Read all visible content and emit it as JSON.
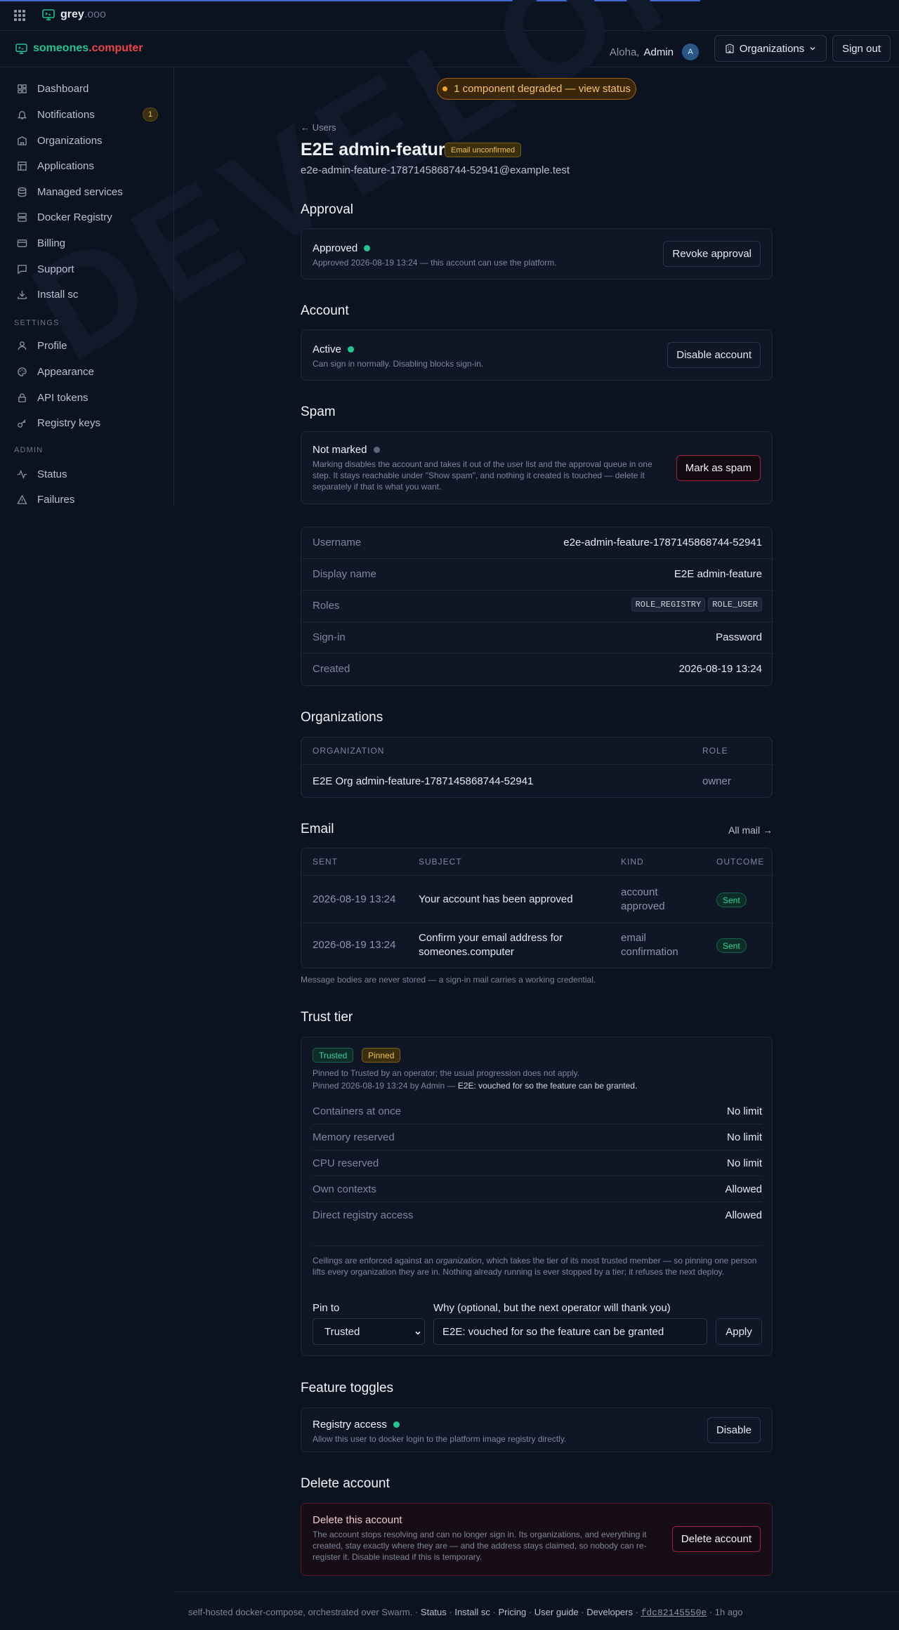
{
  "topbar": {
    "brand_main": "grey",
    "brand_suffix": ".ooo"
  },
  "header": {
    "logo_a": "someones",
    "logo_b": ".computer",
    "greeting": "Aloha,",
    "user_name": "Admin",
    "avatar_initial": "A",
    "org_button": "Organizations",
    "signout_button": "Sign out"
  },
  "sidebar": {
    "items": [
      {
        "label": "Dashboard",
        "icon": "dashboard-icon"
      },
      {
        "label": "Notifications",
        "icon": "bell-icon",
        "badge": "1"
      },
      {
        "label": "Organizations",
        "icon": "building-icon"
      },
      {
        "label": "Applications",
        "icon": "layout-icon"
      },
      {
        "label": "Managed services",
        "icon": "database-icon"
      },
      {
        "label": "Docker Registry",
        "icon": "server-icon"
      },
      {
        "label": "Billing",
        "icon": "card-icon"
      },
      {
        "label": "Support",
        "icon": "chat-icon"
      },
      {
        "label": "Install sc",
        "icon": "download-icon"
      }
    ],
    "settings_label": "SETTINGS",
    "settings_items": [
      {
        "label": "Profile",
        "icon": "user-icon"
      },
      {
        "label": "Appearance",
        "icon": "palette-icon"
      },
      {
        "label": "API tokens",
        "icon": "lock-icon"
      },
      {
        "label": "Registry keys",
        "icon": "key-icon"
      }
    ],
    "admin_label": "ADMIN",
    "admin_items": [
      {
        "label": "Status",
        "icon": "activity-icon"
      },
      {
        "label": "Failures",
        "icon": "warning-icon"
      }
    ]
  },
  "banner": {
    "status_text": "1 component degraded — view status"
  },
  "user": {
    "back_link": "← Users",
    "title": "E2E admin-feature",
    "email_badge": "Email unconfirmed",
    "email": "e2e-admin-feature-1787145868744-52941@example.test"
  },
  "approval": {
    "heading": "Approval",
    "status": "Approved",
    "detail": "Approved 2026-08-19 13:24 — this account can use the platform.",
    "button": "Revoke approval"
  },
  "account": {
    "heading": "Account",
    "status": "Active",
    "detail": "Can sign in normally. Disabling blocks sign-in.",
    "button": "Disable account"
  },
  "spam": {
    "heading": "Spam",
    "status": "Not marked",
    "detail": "Marking disables the account and takes it out of the user list and the approval queue in one step. It stays reachable under \"Show spam\", and nothing it created is touched — delete it separately if that is what you want.",
    "button": "Mark as spam"
  },
  "details": {
    "username_label": "Username",
    "username": "e2e-admin-feature-1787145868744-52941",
    "display_name_label": "Display name",
    "display_name": "E2E admin-feature",
    "roles_label": "Roles",
    "roles": [
      "ROLE_REGISTRY",
      "ROLE_USER"
    ],
    "signin_label": "Sign-in",
    "signin": "Password",
    "created_label": "Created",
    "created": "2026-08-19 13:24"
  },
  "organizations": {
    "heading": "Organizations",
    "col_org": "ORGANIZATION",
    "col_role": "ROLE",
    "rows": [
      {
        "org": "E2E Org admin-feature-1787145868744-52941",
        "role": "owner"
      }
    ]
  },
  "email": {
    "heading": "Email",
    "all_mail": "All mail →",
    "col_sent": "SENT",
    "col_subject": "SUBJECT",
    "col_kind": "KIND",
    "col_outcome": "OUTCOME",
    "rows": [
      {
        "sent": "2026-08-19 13:24",
        "subject": "Your account has been approved",
        "kind": "account approved",
        "outcome": "Sent"
      },
      {
        "sent": "2026-08-19 13:24",
        "subject": "Confirm your email address for someones.computer",
        "kind": "email confirmation",
        "outcome": "Sent"
      }
    ],
    "note": "Message bodies are never stored — a sign-in mail carries a working credential."
  },
  "trust": {
    "heading": "Trust tier",
    "tag_tier": "Trusted",
    "tag_pinned": "Pinned",
    "line1": "Pinned to Trusted by an operator; the usual progression does not apply.",
    "line2_prefix": "Pinned 2026-08-19 13:24 by Admin — ",
    "line2_reason": "E2E: vouched for so the feature can be granted.",
    "limits": [
      {
        "label": "Containers at once",
        "value": "No limit"
      },
      {
        "label": "Memory reserved",
        "value": "No limit"
      },
      {
        "label": "CPU reserved",
        "value": "No limit"
      },
      {
        "label": "Own contexts",
        "value": "Allowed"
      },
      {
        "label": "Direct registry access",
        "value": "Allowed"
      }
    ],
    "note_a": "Ceilings are enforced against an ",
    "note_em": "organization",
    "note_b": ", which takes the tier of its most trusted member — so pinning one person lifts every organization they are in. Nothing already running is ever stopped by a tier; it refuses the next deploy.",
    "pin_label": "Pin to",
    "pin_value": "Trusted",
    "why_label": "Why (optional, but the next operator will thank you)",
    "why_value": "E2E: vouched for so the feature can be granted",
    "apply": "Apply"
  },
  "features": {
    "heading": "Feature toggles",
    "name": "Registry access",
    "detail": "Allow this user to docker login to the platform image registry directly.",
    "button": "Disable"
  },
  "delete": {
    "heading": "Delete account",
    "title": "Delete this account",
    "detail": "The account stops resolving and can no longer sign in. Its organizations, and everything it created, stay exactly where they are — and the address stays claimed, so nobody can re-register it. Disable instead if this is temporary.",
    "button": "Delete account"
  },
  "footer": {
    "prefix": "self-hosted docker-compose, orchestrated over Swarm. · ",
    "links": [
      "Status",
      "Install sc",
      "Pricing",
      "User guide",
      "Developers"
    ],
    "sep": " · ",
    "commit": "fdc82145550e",
    "age": " · 1h ago"
  },
  "watermark": "DEVELOPMENT",
  "colors": {
    "accent_green": "#22c58f",
    "accent_red": "#ef4444",
    "warning": "#f5a524",
    "background": "#0b1220"
  }
}
